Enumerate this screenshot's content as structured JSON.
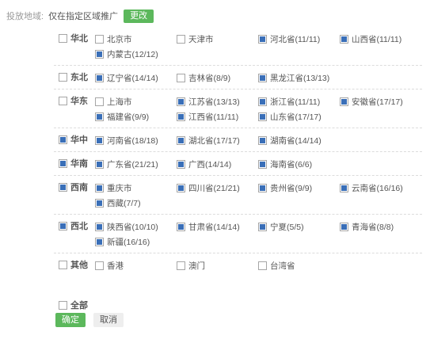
{
  "header": {
    "label": "投放地域:",
    "value": "仅在指定区域推广",
    "change_button": "更改"
  },
  "regions": [
    {
      "name": "华北",
      "checked": false,
      "provinces": [
        {
          "name": "北京市",
          "checked": false
        },
        {
          "name": "天津市",
          "checked": false
        },
        {
          "name": "河北省(11/11)",
          "checked": true
        },
        {
          "name": "山西省(11/11)",
          "checked": true
        },
        {
          "name": "内蒙古(12/12)",
          "checked": true
        }
      ]
    },
    {
      "name": "东北",
      "checked": false,
      "provinces": [
        {
          "name": "辽宁省(14/14)",
          "checked": true
        },
        {
          "name": "吉林省(8/9)",
          "checked": false
        },
        {
          "name": "黑龙江省(13/13)",
          "checked": true
        }
      ]
    },
    {
      "name": "华东",
      "checked": false,
      "provinces": [
        {
          "name": "上海市",
          "checked": false
        },
        {
          "name": "江苏省(13/13)",
          "checked": true
        },
        {
          "name": "浙江省(11/11)",
          "checked": true
        },
        {
          "name": "安徽省(17/17)",
          "checked": true
        },
        {
          "name": "福建省(9/9)",
          "checked": true
        },
        {
          "name": "江西省(11/11)",
          "checked": true
        },
        {
          "name": "山东省(17/17)",
          "checked": true
        }
      ]
    },
    {
      "name": "华中",
      "checked": true,
      "provinces": [
        {
          "name": "河南省(18/18)",
          "checked": true
        },
        {
          "name": "湖北省(17/17)",
          "checked": true
        },
        {
          "name": "湖南省(14/14)",
          "checked": true
        }
      ]
    },
    {
      "name": "华南",
      "checked": true,
      "provinces": [
        {
          "name": "广东省(21/21)",
          "checked": true
        },
        {
          "name": "广西(14/14)",
          "checked": true
        },
        {
          "name": "海南省(6/6)",
          "checked": true
        }
      ]
    },
    {
      "name": "西南",
      "checked": true,
      "provinces": [
        {
          "name": "重庆市",
          "checked": true
        },
        {
          "name": "四川省(21/21)",
          "checked": true
        },
        {
          "name": "贵州省(9/9)",
          "checked": true
        },
        {
          "name": "云南省(16/16)",
          "checked": true
        },
        {
          "name": "西藏(7/7)",
          "checked": true
        }
      ]
    },
    {
      "name": "西北",
      "checked": true,
      "provinces": [
        {
          "name": "陕西省(10/10)",
          "checked": true
        },
        {
          "name": "甘肃省(14/14)",
          "checked": true
        },
        {
          "name": "宁夏(5/5)",
          "checked": true
        },
        {
          "name": "青海省(8/8)",
          "checked": true
        },
        {
          "name": "新疆(16/16)",
          "checked": true
        }
      ]
    },
    {
      "name": "其他",
      "checked": false,
      "provinces": [
        {
          "name": "香港",
          "checked": false
        },
        {
          "name": "澳门",
          "checked": false
        },
        {
          "name": "台湾省",
          "checked": false
        }
      ]
    }
  ],
  "select_all": {
    "label": "全部",
    "checked": false
  },
  "buttons": {
    "confirm": "确定",
    "cancel": "取消"
  },
  "colors": {
    "accent": "#5cb85c",
    "checkbox_fill": "#3a6fb8",
    "divider": "#dcdcdc"
  }
}
